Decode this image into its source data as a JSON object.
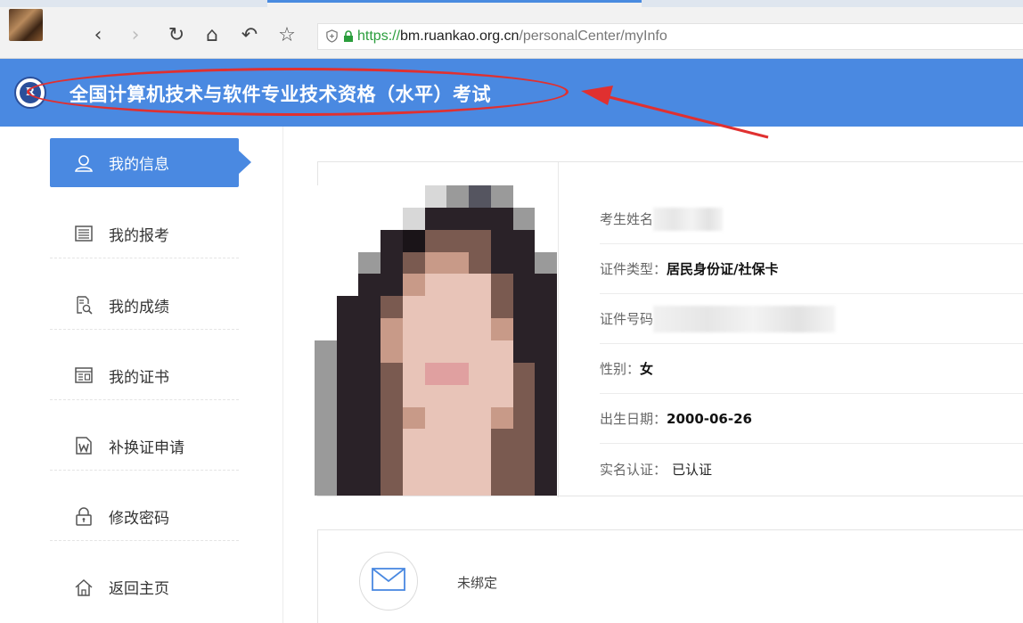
{
  "browser": {
    "url_scheme": "https://",
    "url_host": "bm.ruankao.org.cn",
    "url_path": "/personalCenter/myInfo",
    "back_glyph": "‹",
    "forward_glyph": "›",
    "reload_glyph": "↻",
    "home_glyph": "⌂",
    "undo_glyph": "↶",
    "star_glyph": "☆"
  },
  "header": {
    "title": "全国计算机技术与软件专业技术资格（水平）考试",
    "logo_letter": "R",
    "bg_color": "#4a89e1",
    "annotation_color": "#e03030"
  },
  "sidebar": {
    "items": [
      {
        "label": "我的信息",
        "icon": "user-icon",
        "active": true
      },
      {
        "label": "我的报考",
        "icon": "list-icon",
        "active": false
      },
      {
        "label": "我的成绩",
        "icon": "score-search-icon",
        "active": false
      },
      {
        "label": "我的证书",
        "icon": "certificate-icon",
        "active": false
      },
      {
        "label": "补换证申请",
        "icon": "word-document-icon",
        "active": false
      },
      {
        "label": "修改密码",
        "icon": "lock-icon",
        "active": false
      },
      {
        "label": "返回主页",
        "icon": "home-icon",
        "active": false
      }
    ]
  },
  "profile": {
    "name_label": "考生姓名",
    "id_type_label": "证件类型：",
    "id_type_value": "居民身份证/社保卡",
    "id_number_label": "证件号码",
    "gender_label": "性别：",
    "gender_value": "女",
    "birth_label": "出生日期：",
    "birth_value": "2000-06-26",
    "realname_label": "实名认证：",
    "realname_value": "已认证"
  },
  "contact": {
    "email_status": "未绑定",
    "icon": "envelope-icon"
  }
}
